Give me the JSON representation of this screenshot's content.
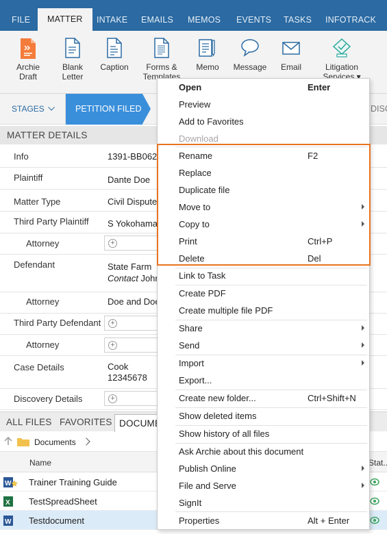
{
  "tabs": [
    "FILE",
    "MATTER",
    "INTAKE",
    "EMAILS",
    "MEMOS",
    "EVENTS",
    "TASKS",
    "INFOTRACK"
  ],
  "ribbon": {
    "archie": "Archie\nDraft",
    "blank": "Blank\nLetter",
    "caption": "Caption",
    "forms": "Forms &\nTemplates",
    "memo": "Memo",
    "message": "Message",
    "email": "Email",
    "litigation": "Litigation\nServices ▾"
  },
  "stages": {
    "label": "STAGES",
    "active": "PETITION FILED",
    "next": "DISC"
  },
  "matter_details": {
    "heading": "MATTER DETAILS",
    "info_k": "Info",
    "info_v": "1391-BB062",
    "plaintiff_k": "Plaintiff",
    "plaintiff_v": "Dante Doe",
    "type_k": "Matter Type",
    "type_v": "Civil Dispute",
    "tpp_k": "Third Party Plaintiff",
    "tpp_v": "S Yokohama",
    "attorney_k": "Attorney",
    "defendant_k": "Defendant",
    "defendant_v": "State Farm",
    "defendant_contact_label": "Contact",
    "defendant_contact": "John",
    "def_attorney_v": "Doe and Doe",
    "tpd_k": "Third Party Defendant",
    "case_k": "Case Details",
    "case_v1": "Cook",
    "case_v2": "12345678",
    "discovery_k": "Discovery Details"
  },
  "bottom_tabs": {
    "all": "ALL FILES",
    "fav": "FAVORITES",
    "docs": "DOCUMEN"
  },
  "breadcrumb": {
    "folder": "Documents"
  },
  "columns": {
    "name": "Name",
    "status": "Stat..."
  },
  "files": [
    {
      "name": "Trainer Training Guide"
    },
    {
      "name": "TestSpreadSheet"
    },
    {
      "name": "Testdocument"
    }
  ],
  "menu": {
    "open": "Open",
    "open_key": "Enter",
    "preview": "Preview",
    "favorites": "Add to Favorites",
    "download": "Download",
    "rename": "Rename",
    "rename_key": "F2",
    "replace": "Replace",
    "duplicate": "Duplicate file",
    "move": "Move to",
    "copy": "Copy to",
    "print": "Print",
    "print_key": "Ctrl+P",
    "delete": "Delete",
    "delete_key": "Del",
    "link": "Link to Task",
    "pdf": "Create PDF",
    "multipdf": "Create multiple file PDF",
    "share": "Share",
    "send": "Send",
    "import": "Import",
    "export": "Export...",
    "newfolder": "Create new folder...",
    "newfolder_key": "Ctrl+Shift+N",
    "showdeleted": "Show deleted items",
    "history": "Show history of all files",
    "archie": "Ask Archie about this document",
    "publish": "Publish Online",
    "fileserve": "File and Serve",
    "signit": "SignIt",
    "properties": "Properties",
    "properties_key": "Alt + Enter"
  },
  "colors": {
    "tabbar": "#2b6aa2",
    "accent": "#3a8fdb",
    "highlight": "#e8731f",
    "selected": "#dcebf8"
  }
}
